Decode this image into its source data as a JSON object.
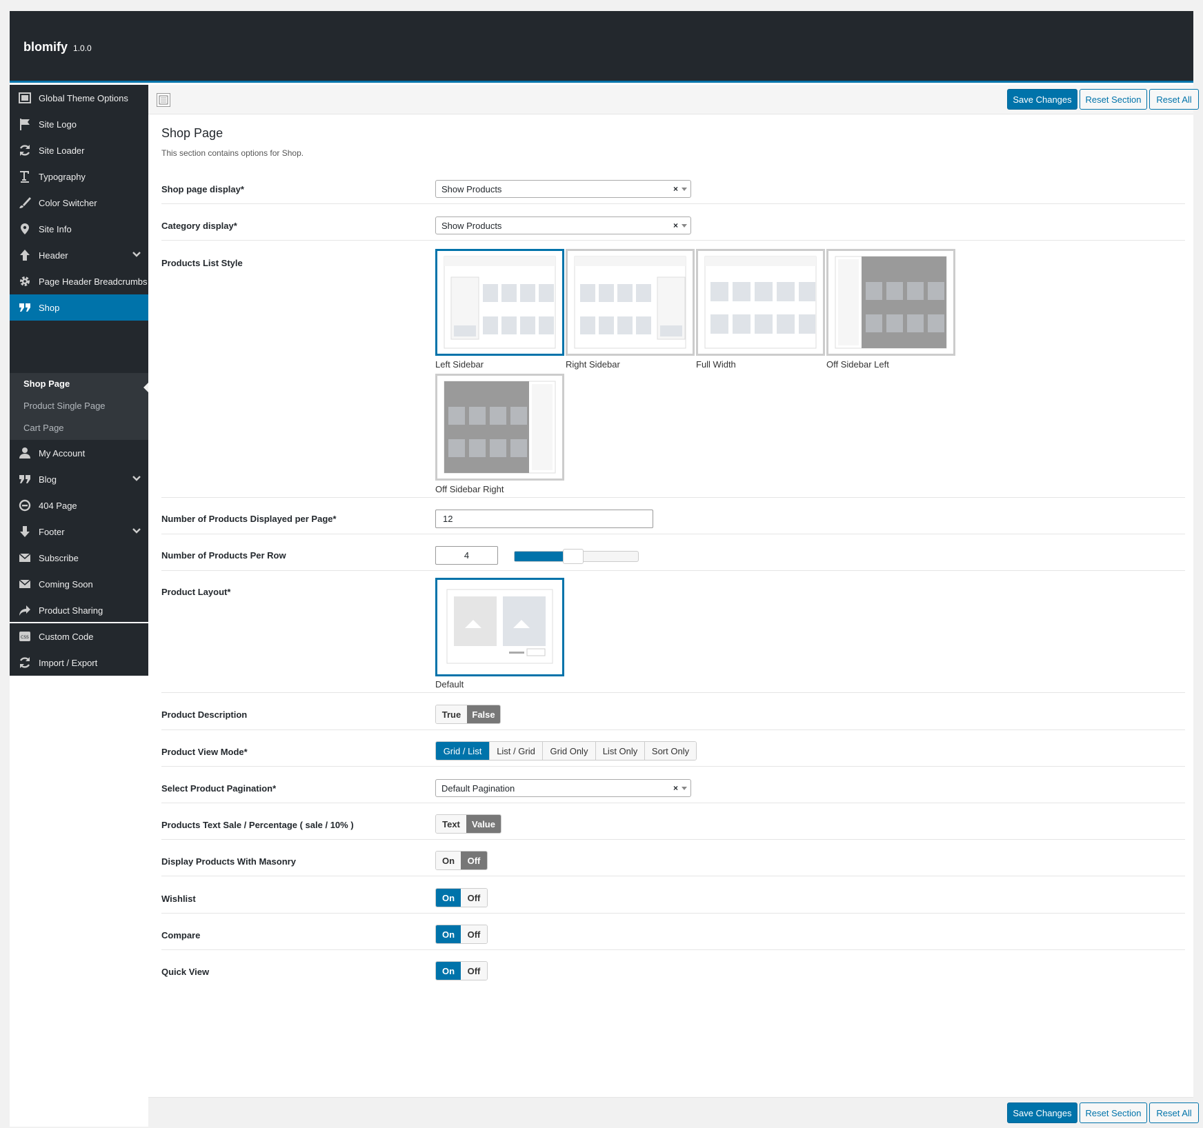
{
  "app": {
    "name": "blomify",
    "version": "1.0.0"
  },
  "toolbar": {
    "save": "Save Changes",
    "reset_section": "Reset Section",
    "reset_all": "Reset All"
  },
  "sidebar": {
    "items": [
      {
        "label": "Global Theme Options",
        "icon": "panel-icon"
      },
      {
        "label": "Site Logo",
        "icon": "flag-icon"
      },
      {
        "label": "Site Loader",
        "icon": "refresh-icon"
      },
      {
        "label": "Typography",
        "icon": "text-icon"
      },
      {
        "label": "Color Switcher",
        "icon": "brush-icon"
      },
      {
        "label": "Site Info",
        "icon": "pin-icon"
      },
      {
        "label": "Header",
        "icon": "arrow-up-icon"
      },
      {
        "label": "Page Header Breadcrumbs",
        "icon": "gear-icon"
      },
      {
        "label": "Shop",
        "icon": "quote-icon"
      },
      {
        "label": "My Account",
        "icon": "user-icon"
      },
      {
        "label": "Blog",
        "icon": "quote-icon"
      },
      {
        "label": "404 Page",
        "icon": "minus-circle-icon"
      },
      {
        "label": "Footer",
        "icon": "arrow-down-icon"
      },
      {
        "label": "Subscribe",
        "icon": "mail-icon"
      },
      {
        "label": "Coming Soon",
        "icon": "mail-icon"
      },
      {
        "label": "Product Sharing",
        "icon": "share-icon"
      },
      {
        "label": "Custom Code",
        "icon": "css-icon"
      },
      {
        "label": "Import / Export",
        "icon": "refresh-icon"
      }
    ],
    "subitems": [
      "Shop Page",
      "Product Single Page",
      "Cart Page"
    ]
  },
  "section": {
    "title": "Shop Page",
    "description": "This section contains options for Shop."
  },
  "fields": {
    "shop_display": {
      "label": "Shop page display*",
      "value": "Show Products"
    },
    "category_display": {
      "label": "Category display*",
      "value": "Show Products"
    },
    "list_style": {
      "label": "Products List Style",
      "options": [
        "Left Sidebar",
        "Right Sidebar",
        "Full Width",
        "Off Sidebar Left",
        "Off Sidebar Right"
      ],
      "selected": "Left Sidebar"
    },
    "per_page": {
      "label": "Number of Products Displayed per Page*",
      "value": "12"
    },
    "per_row": {
      "label": "Number of Products Per Row",
      "value": "4",
      "slider_fraction": 0.4
    },
    "product_layout": {
      "label": "Product Layout*",
      "option": "Default"
    },
    "description": {
      "label": "Product Description",
      "options": [
        "True",
        "False"
      ],
      "selected": "False"
    },
    "view_mode": {
      "label": "Product View Mode*",
      "options": [
        "Grid / List",
        "List / Grid",
        "Grid Only",
        "List Only",
        "Sort Only"
      ],
      "selected": "Grid / List"
    },
    "pagination": {
      "label": "Select Product Pagination*",
      "value": "Default Pagination"
    },
    "sale_text": {
      "label": "Products Text Sale / Percentage ( sale / 10% )",
      "options": [
        "Text",
        "Value"
      ],
      "selected": "Value"
    },
    "masonry": {
      "label": "Display Products With Masonry",
      "options": [
        "On",
        "Off"
      ],
      "selected": "Off"
    },
    "wishlist": {
      "label": "Wishlist",
      "options": [
        "On",
        "Off"
      ],
      "selected": "On"
    },
    "compare": {
      "label": "Compare",
      "options": [
        "On",
        "Off"
      ],
      "selected": "On"
    },
    "quick_view": {
      "label": "Quick View",
      "options": [
        "On",
        "Off"
      ],
      "selected": "On"
    }
  },
  "colors": {
    "accent": "#0073aa",
    "sidebar": "#23282d"
  }
}
